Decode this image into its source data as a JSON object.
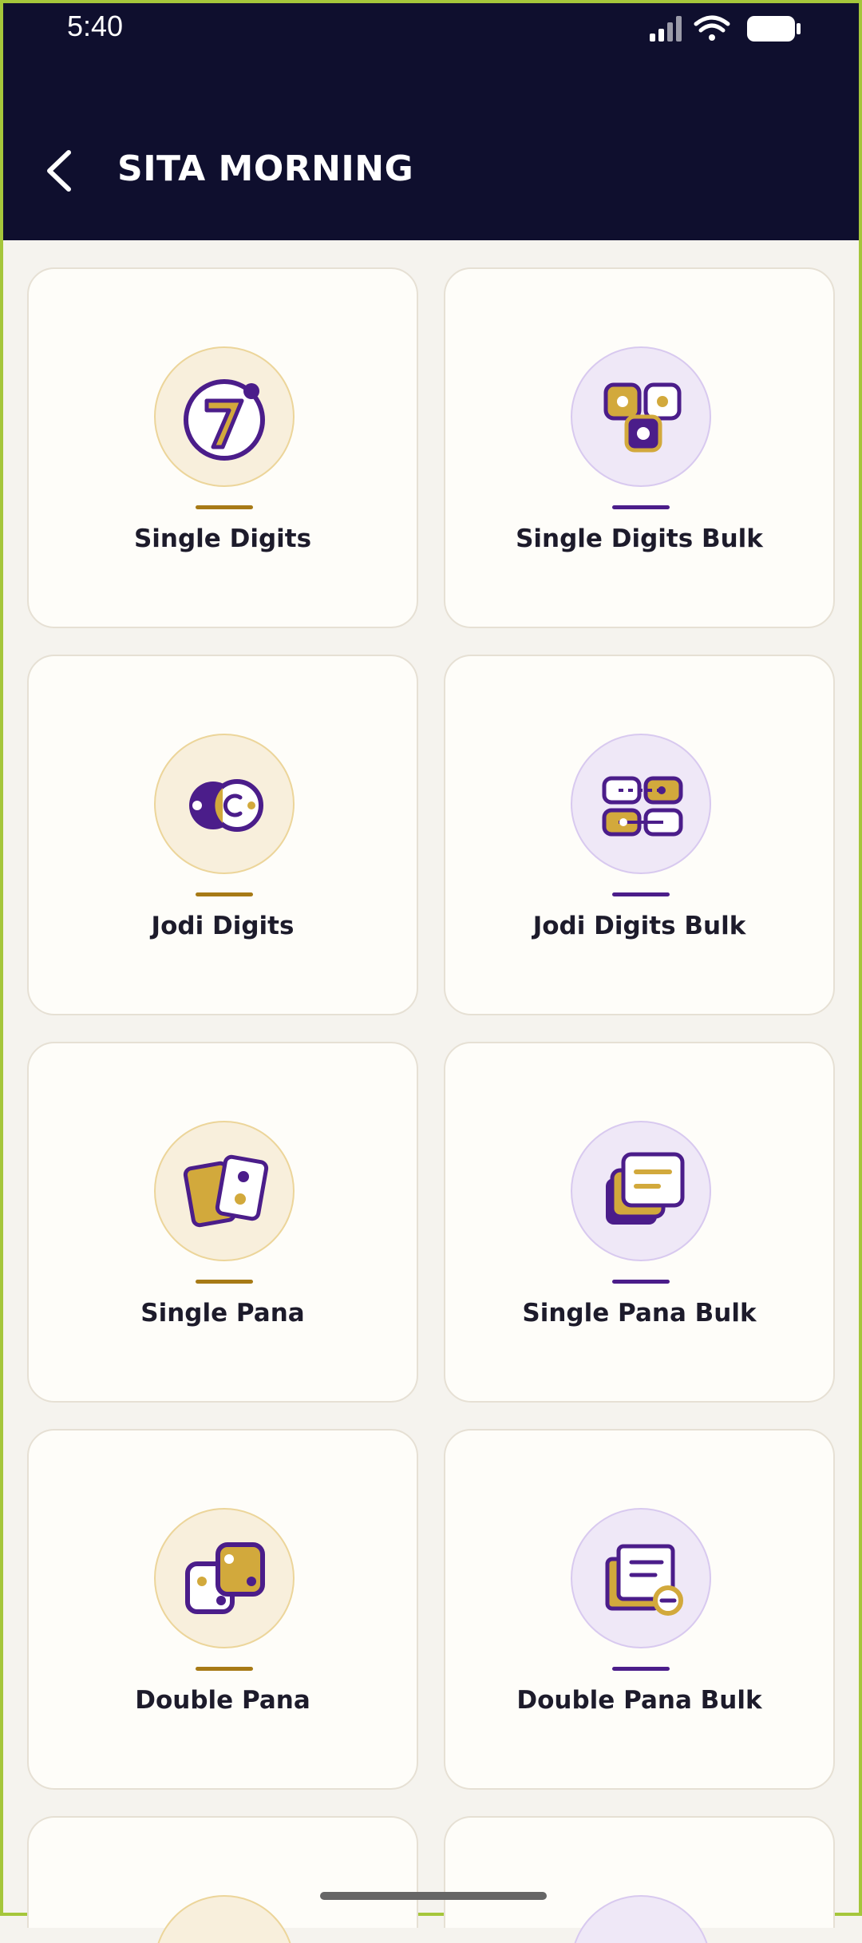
{
  "status_bar": {
    "time": "5:40",
    "icons": [
      "signal-icon",
      "wifi-icon",
      "battery-icon"
    ]
  },
  "header": {
    "title": "SITA MORNING",
    "back_icon": "back-arrow-icon"
  },
  "colors": {
    "header_bg": "#0f0f2e",
    "gold": "#a77a16",
    "purple": "#4b1d8a",
    "page_bg": "#f5f3ee"
  },
  "games": [
    {
      "label": "Single Digits",
      "icon": "single-digit-icon",
      "theme": "gold"
    },
    {
      "label": "Single Digits Bulk",
      "icon": "single-digits-bulk-icon",
      "theme": "purple"
    },
    {
      "label": "Jodi Digits",
      "icon": "jodi-digits-icon",
      "theme": "gold"
    },
    {
      "label": "Jodi Digits Bulk",
      "icon": "jodi-digits-bulk-icon",
      "theme": "purple"
    },
    {
      "label": "Single Pana",
      "icon": "single-pana-icon",
      "theme": "gold"
    },
    {
      "label": "Single Pana Bulk",
      "icon": "single-pana-bulk-icon",
      "theme": "purple"
    },
    {
      "label": "Double Pana",
      "icon": "double-pana-icon",
      "theme": "gold"
    },
    {
      "label": "Double Pana Bulk",
      "icon": "double-pana-bulk-icon",
      "theme": "purple"
    }
  ]
}
